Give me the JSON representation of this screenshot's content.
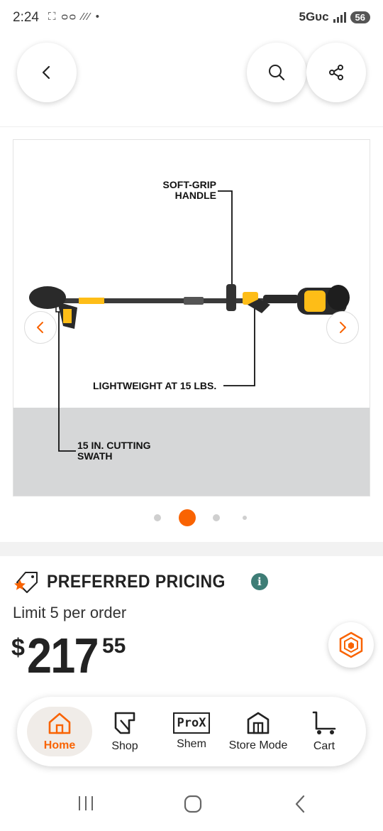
{
  "status_bar": {
    "time": "2:24",
    "left_icons": "⛶ ᴑᴑ ⁄⁄⁄ •",
    "network": "5Gᴜᴄ",
    "battery": "56"
  },
  "header": {
    "back_icon": "chevron-left-icon",
    "search_icon": "search-icon",
    "share_icon": "share-icon"
  },
  "product_image": {
    "callouts": {
      "soft_grip": [
        "SOFT-GRIP",
        "HANDLE"
      ],
      "lightweight": "LIGHTWEIGHT AT 15 LBS.",
      "swath": [
        "15 IN. CUTTING",
        "SWATH"
      ]
    },
    "colors": {
      "accent": "#febd17",
      "tool_body": "#2a2a2a",
      "floor": "#d6d7d8"
    }
  },
  "carousel": {
    "dots": 4,
    "active_index": 1,
    "active_color": "#f96302"
  },
  "pricing": {
    "badge_label": "PREFERRED PRICING",
    "info_icon": "i",
    "limit": "Limit 5 per order",
    "currency": "$",
    "dollars": "217",
    "cents": "55"
  },
  "bottom_nav": {
    "items": [
      {
        "label": "Home",
        "icon": "home-icon",
        "active": true
      },
      {
        "label": "Shop",
        "icon": "shop-tag-icon"
      },
      {
        "label": "Shem",
        "icon": "prox-icon",
        "badge_text": "ProX"
      },
      {
        "label": "Store Mode",
        "icon": "store-icon"
      },
      {
        "label": "Cart",
        "icon": "cart-icon"
      }
    ]
  },
  "brand_color": "#f96302"
}
